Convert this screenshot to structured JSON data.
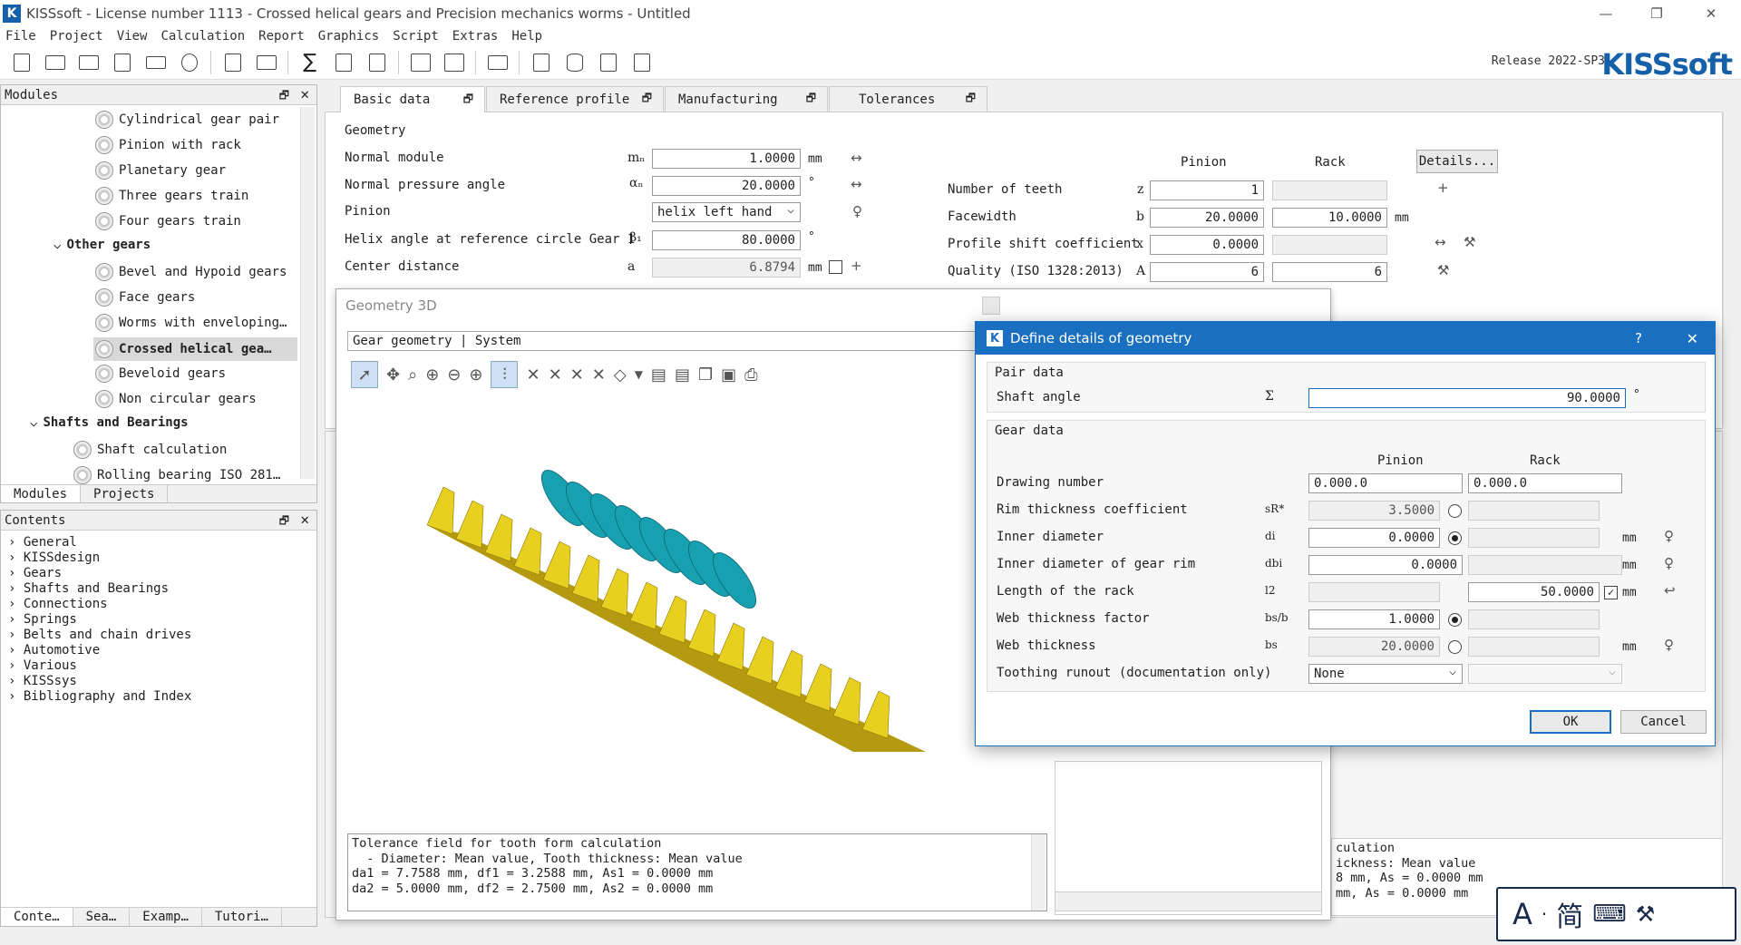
{
  "window": {
    "title": "KISSsoft - License number 1113 - Crossed helical gears and Precision mechanics worms - Untitled"
  },
  "menu": [
    "File",
    "Project",
    "View",
    "Calculation",
    "Report",
    "Graphics",
    "Script",
    "Extras",
    "Help"
  ],
  "release": "Release 2022-SP3",
  "brand": "KISSsoft",
  "modules": {
    "header": "Modules",
    "items": [
      "Cylindrical gear pair",
      "Pinion with rack",
      "Planetary gear",
      "Three gears train",
      "Four gears train",
      "Other gears",
      "Bevel and Hypoid gears",
      "Face gears",
      "Worms with enveloping…",
      "Crossed helical gea…",
      "Beveloid gears",
      "Non circular gears",
      "Shafts and Bearings",
      "Shaft calculation",
      "Rolling bearing ISO 281…"
    ],
    "tabs": [
      "Modules",
      "Projects"
    ]
  },
  "contents": {
    "header": "Contents",
    "items": [
      "General",
      "KISSdesign",
      "Gears",
      "Shafts and Bearings",
      "Connections",
      "Springs",
      "Belts and chain drives",
      "Automotive",
      "Various",
      "KISSsys",
      "Bibliography and Index"
    ],
    "tabs": [
      "Conte…",
      "Sea…",
      "Examp…",
      "Tutori…"
    ]
  },
  "main_tabs": [
    "Basic data",
    "Reference profile",
    "Manufacturing",
    "Tolerances"
  ],
  "geometry": {
    "group": "Geometry",
    "normal_module": {
      "label": "Normal module",
      "sym": "mₙ",
      "value": "1.0000",
      "unit": "mm"
    },
    "pressure_angle": {
      "label": "Normal pressure angle",
      "sym": "αₙ",
      "value": "20.0000",
      "unit": "°"
    },
    "pinion": {
      "label": "Pinion",
      "value": "helix left hand"
    },
    "helix_angle": {
      "label": "Helix angle at reference circle Gear 1",
      "sym": "β₁",
      "value": "80.0000",
      "unit": "°"
    },
    "center_distance": {
      "label": "Center distance",
      "sym": "a",
      "value": "6.8794",
      "unit": "mm"
    },
    "col_pinion": "Pinion",
    "col_rack": "Rack",
    "details_button": "Details...",
    "teeth": {
      "label": "Number of teeth",
      "sym": "z",
      "pinion": "1",
      "rack": ""
    },
    "facewidth": {
      "label": "Facewidth",
      "sym": "b",
      "pinion": "20.0000",
      "rack": "10.0000",
      "unit": "mm"
    },
    "profile_shift": {
      "label": "Profile shift coefficient",
      "sym": "x",
      "pinion": "0.0000",
      "rack": ""
    },
    "quality": {
      "label": "Quality (ISO 1328:2013)",
      "sym": "A",
      "pinion": "6",
      "rack": "6"
    }
  },
  "geo3d": {
    "title": "Geometry 3D",
    "dropdown": "Gear geometry | System",
    "output_lines": [
      "Tolerance field for tooth form calculation",
      "  - Diameter: Mean value, Tooth thickness: Mean value",
      "da1 = 7.7588 mm, df1 = 3.2588 mm, As1 = 0.0000 mm",
      "da2 = 5.0000 mm, df2 = 2.7500 mm, As2 = 0.0000 mm"
    ]
  },
  "right_output_lines": [
    "culation",
    "ickness: Mean value",
    "8 mm, As = 0.0000 mm",
    "mm, As = 0.0000 mm"
  ],
  "dialog": {
    "title": "Define details of geometry",
    "help": "?",
    "pair_group": "Pair data",
    "shaft_angle": {
      "label": "Shaft angle",
      "sym": "Σ",
      "value": "90.0000",
      "unit": "°"
    },
    "gear_group": "Gear data",
    "col_pinion": "Pinion",
    "col_rack": "Rack",
    "rows": [
      {
        "label": "Drawing number",
        "sym": "",
        "pinion": "0.000.0",
        "rack": "0.000.0",
        "unit": ""
      },
      {
        "label": "Rim thickness coefficient",
        "sym": "sR*",
        "pinion": "3.5000",
        "rack": "",
        "unit": ""
      },
      {
        "label": "Inner diameter",
        "sym": "di",
        "pinion": "0.0000",
        "rack": "",
        "unit": "mm"
      },
      {
        "label": "Inner diameter of gear rim",
        "sym": "dbi",
        "pinion": "0.0000",
        "rack": "",
        "unit": "mm"
      },
      {
        "label": "Length of the rack",
        "sym": "l2",
        "pinion": "",
        "rack": "50.0000",
        "unit": "mm"
      },
      {
        "label": "Web thickness factor",
        "sym": "bs/b",
        "pinion": "1.0000",
        "rack": "",
        "unit": ""
      },
      {
        "label": "Web thickness",
        "sym": "bs",
        "pinion": "20.0000",
        "rack": "",
        "unit": "mm"
      },
      {
        "label": "Toothing runout (documentation only)",
        "sym": "",
        "pinion": "None",
        "rack": "",
        "unit": ""
      }
    ],
    "ok": "OK",
    "cancel": "Cancel"
  },
  "ime": {
    "letter": "A",
    "sep": "·",
    "chinese": "简"
  },
  "colors": {
    "accent": "#1a6fc1",
    "brand": "#1560a8",
    "rack": "#e8d020",
    "worm": "#17a0b0"
  }
}
